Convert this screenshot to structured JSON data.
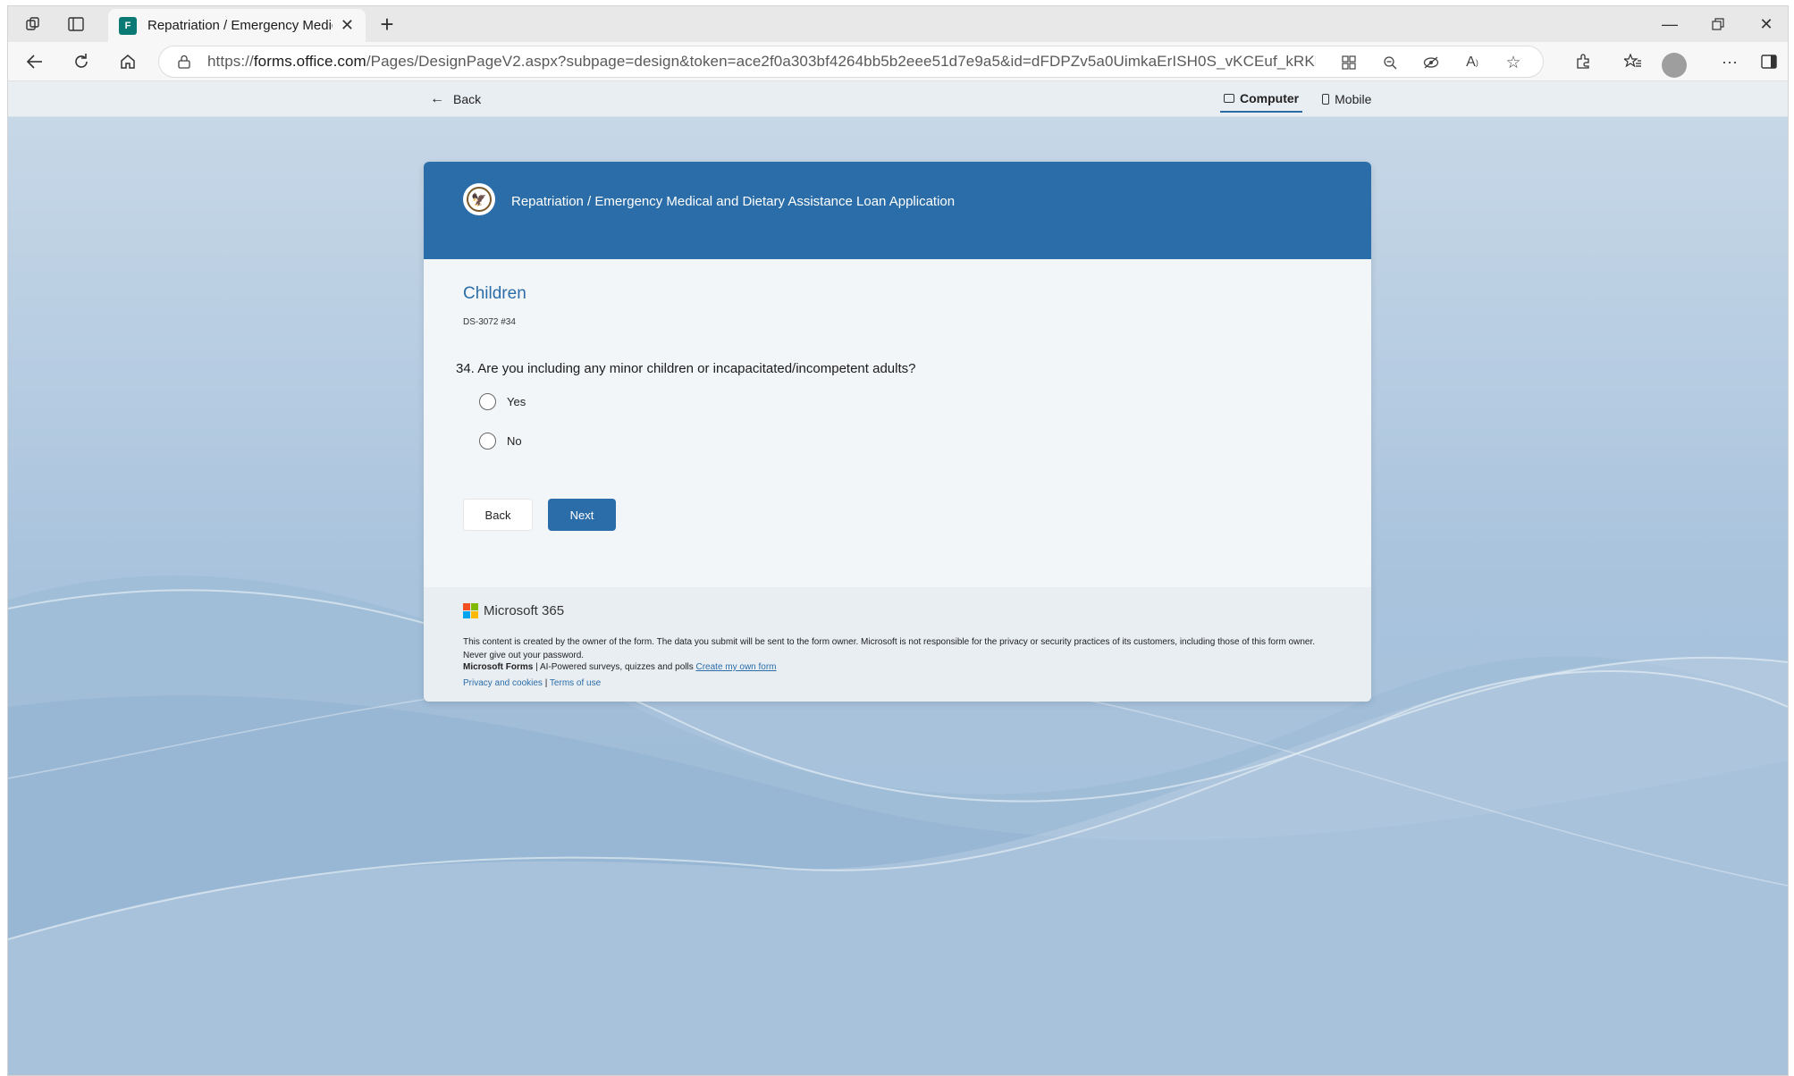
{
  "browser": {
    "tab_title": "Repatriation / Emergency Medical and Dietary Assistance Loan Application",
    "tab_favicon_letter": "F",
    "url_prefix": "https://",
    "url_domain": "forms.office.com",
    "url_path": "/Pages/DesignPageV2.aspx?subpage=design&token=ace2f0a303bf4264bb5b2eee51d7e9a5&id=dFDPZv5a0UimkaErISH0S_vKCEuf_kRKkT55Dw..."
  },
  "toolbar": {
    "back_label": "Back",
    "computer_label": "Computer",
    "mobile_label": "Mobile"
  },
  "form": {
    "title": "Repatriation / Emergency Medical and Dietary Assistance Loan Application",
    "section_title": "Children",
    "section_subtitle": "DS-3072 #34",
    "question": "34. Are you including any minor children or incapacitated/incompetent adults?",
    "options": [
      "Yes",
      "No"
    ],
    "back_button": "Back",
    "next_button": "Next"
  },
  "footer": {
    "brand": "Microsoft 365",
    "disclaimer": "This content is created by the owner of the form. The data you submit will be sent to the form owner. Microsoft is not responsible for the privacy or security practices of its customers, including those of this form owner. Never give out your password.",
    "product_name": "Microsoft Forms",
    "product_tagline": " | AI-Powered surveys, quizzes and polls ",
    "create_link": "Create my own form",
    "privacy_link": "Privacy and cookies",
    "separator": " | ",
    "terms_link": "Terms of use"
  },
  "colors": {
    "accent": "#2b6da8",
    "ms_red": "#f25022",
    "ms_green": "#7fba00",
    "ms_blue": "#00a4ef",
    "ms_yellow": "#ffb900"
  }
}
